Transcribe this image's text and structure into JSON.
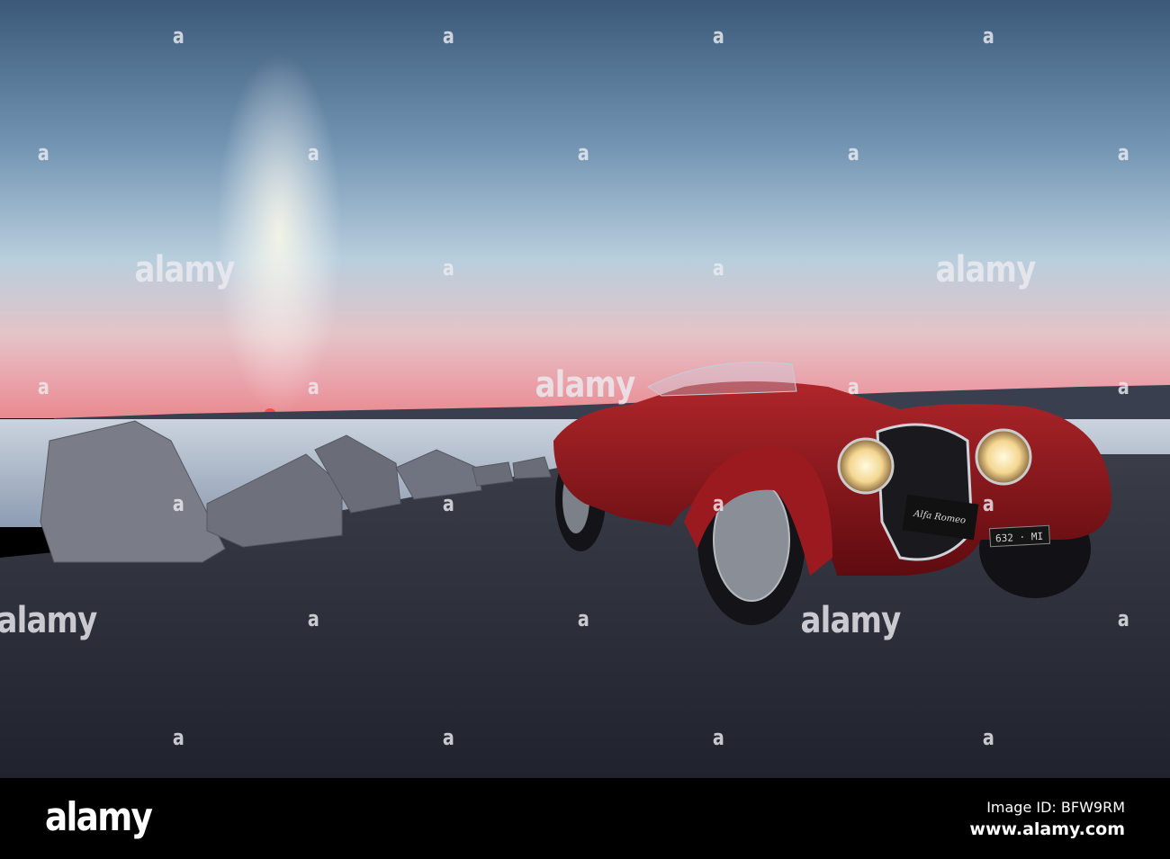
{
  "photo": {
    "subject": "Red vintage roadster at sunset by the sea",
    "license_plate": "632 · MI",
    "badge_text": "Alfa Romeo",
    "colors": {
      "sky_top": "#3b5878",
      "sky_mid": "#9cb9d0",
      "sky_pink": "#eaa6ad",
      "car_red": "#8e1418",
      "ground": "#272a36"
    }
  },
  "watermark": {
    "large_text": "alamy",
    "small_text": "a"
  },
  "footer": {
    "logo": "alamy",
    "image_id": "Image ID: BFW9RM",
    "url": "www.alamy.com"
  }
}
